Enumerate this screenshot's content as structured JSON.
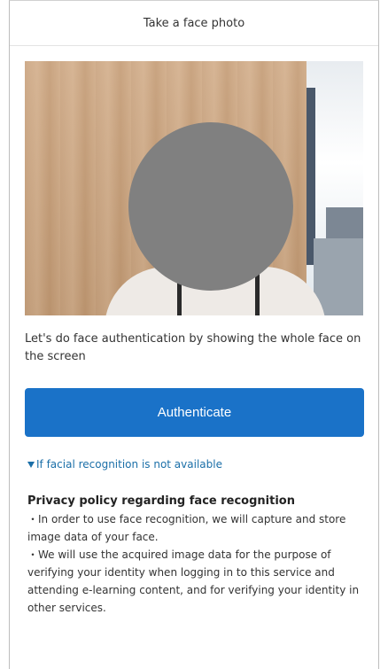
{
  "header": {
    "title": "Take a face photo"
  },
  "camera": {
    "feed_state": "face masked"
  },
  "instruction": "Let's do face authentication by showing the whole face on the screen",
  "authenticate_button": {
    "label": "Authenticate",
    "color": "#1a72c8"
  },
  "fallback": {
    "icon": "triangle-down-icon",
    "label": "If facial recognition is not available"
  },
  "privacy": {
    "title": "Privacy policy regarding face recognition",
    "items": [
      "・In order to use face recognition, we will capture and store image data of your face.",
      "・We will use the acquired image data for the purpose of verifying your identity when logging in to this service and attending e-learning content, and for verifying your identity in other services."
    ]
  },
  "colors": {
    "accent": "#1a72c8",
    "link": "#1b6fa8",
    "face_mask": "#808080"
  }
}
